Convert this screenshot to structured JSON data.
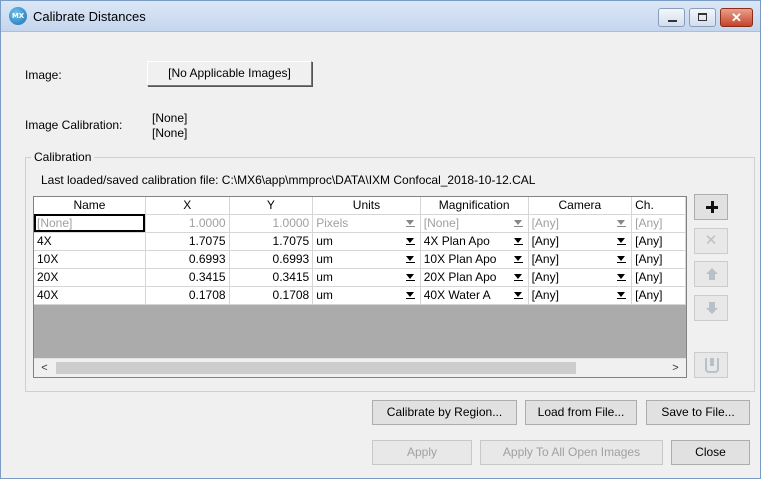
{
  "window": {
    "title": "Calibrate Distances",
    "app_icon_text": "MX",
    "close_glyph": "✕"
  },
  "image": {
    "label": "Image:",
    "button": "[No Applicable Images]"
  },
  "image_calibration": {
    "label": "Image Calibration:",
    "value1": "[None]",
    "value2": "[None]"
  },
  "calibration": {
    "group_label": "Calibration",
    "file_text": "Last loaded/saved calibration file: C:\\MX6\\app\\mmproc\\DATA\\IXM Confocal_2018-10-12.CAL",
    "columns": [
      "Name",
      "X",
      "Y",
      "Units",
      "Magnification",
      "Camera",
      "Ch."
    ],
    "rows": [
      {
        "name": "[None]",
        "x": "1.0000",
        "y": "1.0000",
        "units": "Pixels",
        "magnification": "[None]",
        "camera": "[Any]",
        "channel": "[Any]"
      },
      {
        "name": "4X",
        "x": "1.7075",
        "y": "1.7075",
        "units": "um",
        "magnification": "4X Plan Apo",
        "camera": "[Any]",
        "channel": "[Any]"
      },
      {
        "name": "10X",
        "x": "0.6993",
        "y": "0.6993",
        "units": "um",
        "magnification": "10X Plan Apo",
        "camera": "[Any]",
        "channel": "[Any]"
      },
      {
        "name": "20X",
        "x": "0.3415",
        "y": "0.3415",
        "units": "um",
        "magnification": "20X Plan Apo",
        "camera": "[Any]",
        "channel": "[Any]"
      },
      {
        "name": "40X",
        "x": "0.1708",
        "y": "0.1708",
        "units": "um",
        "magnification": "40X Water A",
        "camera": "[Any]",
        "channel": "[Any]"
      }
    ],
    "scroll_left": "<",
    "scroll_right": ">"
  },
  "icons": {
    "add": "plus-icon",
    "delete": "delete-icon",
    "move_up": "arrow-up-icon",
    "move_down": "arrow-down-icon",
    "save": "save-icon",
    "delete_glyph": "✕"
  },
  "buttons": {
    "calibrate_by_region": "Calibrate by Region...",
    "load_from_file": "Load from File...",
    "save_to_file": "Save to File...",
    "apply": "Apply",
    "apply_all": "Apply To All Open Images",
    "close": "Close"
  }
}
